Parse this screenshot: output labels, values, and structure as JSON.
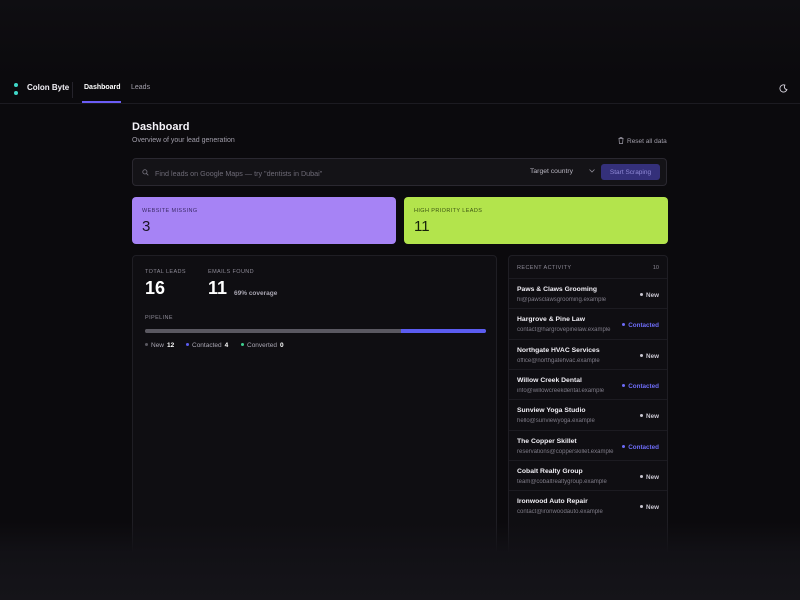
{
  "app": {
    "brand": "Colon Byte",
    "nav": {
      "dashboard": "Dashboard",
      "leads": "Leads"
    },
    "accent": "#6b5cf6"
  },
  "header": {
    "title": "Dashboard",
    "subtitle": "Overview of your lead generation",
    "reset_label": "Reset all data"
  },
  "search": {
    "placeholder": "Find leads on Google Maps — try \"dentists in Dubai\"",
    "value": "",
    "country_label": "Target country",
    "button_label": "Start Scraping"
  },
  "highlights": {
    "website_missing": {
      "label": "WEBSITE MISSING",
      "value": "3",
      "color": "#a683f5"
    },
    "high_priority": {
      "label": "HIGH PRIORITY LEADS",
      "value": "11",
      "color": "#b3e44c"
    }
  },
  "metrics": {
    "total_leads": {
      "label": "TOTAL LEADS",
      "value": "16"
    },
    "emails_found": {
      "label": "EMAILS FOUND",
      "value": "11",
      "coverage": "69% coverage"
    }
  },
  "pipeline": {
    "label": "PIPELINE",
    "stages": [
      {
        "name": "New",
        "count": "12",
        "color": "#5a5861"
      },
      {
        "name": "Contacted",
        "count": "4",
        "color": "#5b5cf0"
      },
      {
        "name": "Converted",
        "count": "0",
        "color": "#3ecf8e"
      }
    ]
  },
  "activity": {
    "title": "RECENT ACTIVITY",
    "count": "10",
    "items": [
      {
        "name": "Paws & Claws Grooming",
        "email": "hi@pawsclawsgrooming.example",
        "status": "New"
      },
      {
        "name": "Hargrove & Pine Law",
        "email": "contact@hargrovepinelaw.example",
        "status": "Contacted"
      },
      {
        "name": "Northgate HVAC Services",
        "email": "office@northgatehvac.example",
        "status": "New"
      },
      {
        "name": "Willow Creek Dental",
        "email": "info@willowcreekdental.example",
        "status": "Contacted"
      },
      {
        "name": "Sunview Yoga Studio",
        "email": "hello@sunviewyoga.example",
        "status": "New"
      },
      {
        "name": "The Copper Skillet",
        "email": "reservations@copperskillet.example",
        "status": "Contacted"
      },
      {
        "name": "Cobalt Realty Group",
        "email": "team@cobaltrealtygroup.example",
        "status": "New"
      },
      {
        "name": "Ironwood Auto Repair",
        "email": "contact@ironwoodauto.example",
        "status": "New"
      }
    ],
    "status_colors": {
      "New": "#c9c6d1",
      "Contacted": "#6d6cf7"
    }
  }
}
